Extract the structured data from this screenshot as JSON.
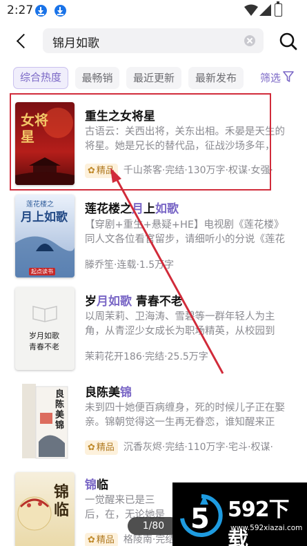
{
  "status": {
    "time": "2:27"
  },
  "search": {
    "query": "锦月如歌"
  },
  "tabs": [
    {
      "label": "综合热度",
      "active": true
    },
    {
      "label": "最畅销",
      "active": false
    },
    {
      "label": "最近更新",
      "active": false
    },
    {
      "label": "最新发布",
      "active": false
    }
  ],
  "filter_label": "筛选",
  "books": [
    {
      "title": "重生之女将星",
      "desc": "古语云：关西出将，关东出相。禾晏是天生的将星。她是兄长的替代品，征战沙场多年，",
      "badge": "精品",
      "meta": "千山茶客·完结·130万字·权谋·女强·"
    },
    {
      "title_parts": [
        "莲花楼之",
        "月",
        "上",
        "如歌"
      ],
      "desc": "【穿剧+重生+悬疑+HE】电视剧《莲花楼》同人文各位看官留步，请细听小的分说《莲花",
      "meta": "滕乔笙·连载·1.5万字"
    },
    {
      "title_parts": [
        "岁",
        "月如歌",
        " 青春不老"
      ],
      "desc": "以周茉莉、卫海涛、雪碧等一群年轻人为主角，从青涩少女成长为职场精英，从校园到",
      "meta": "茉莉花开186·完结·25.5万字"
    },
    {
      "title_parts": [
        "良陈美",
        "锦"
      ],
      "desc": "未到四十她便百病缠身，死的时候儿子正在娶亲。锦朝觉得这一生再无眷恋，谁知醒来正",
      "badge": "精品",
      "meta": "沉香灰烬·完结·110万字·宅斗·权谋·"
    },
    {
      "title_parts": [
        "锦",
        "临"
      ],
      "desc": "一觉醒来已是三后，在，无论她是谁，都",
      "badge": "精品",
      "meta": "格陵南·完结"
    }
  ],
  "covers": {
    "book1": {
      "text": "女将星"
    },
    "book2": {
      "top": "莲花楼之",
      "main": "月上如歌",
      "publisher": "起点读书"
    },
    "book3": {
      "line1": "岁月如歌",
      "line2": "青春不老"
    },
    "book4": {
      "text": "良陈美锦"
    },
    "book5": {
      "text": "锦临"
    }
  },
  "pager": "1/80",
  "watermark": {
    "brand": "592下载",
    "url": "www.592xiazai.com"
  },
  "colors": {
    "accent": "#7a67c6",
    "annotation": "#d12b3a",
    "badge_bg": "#fdf1dc"
  }
}
